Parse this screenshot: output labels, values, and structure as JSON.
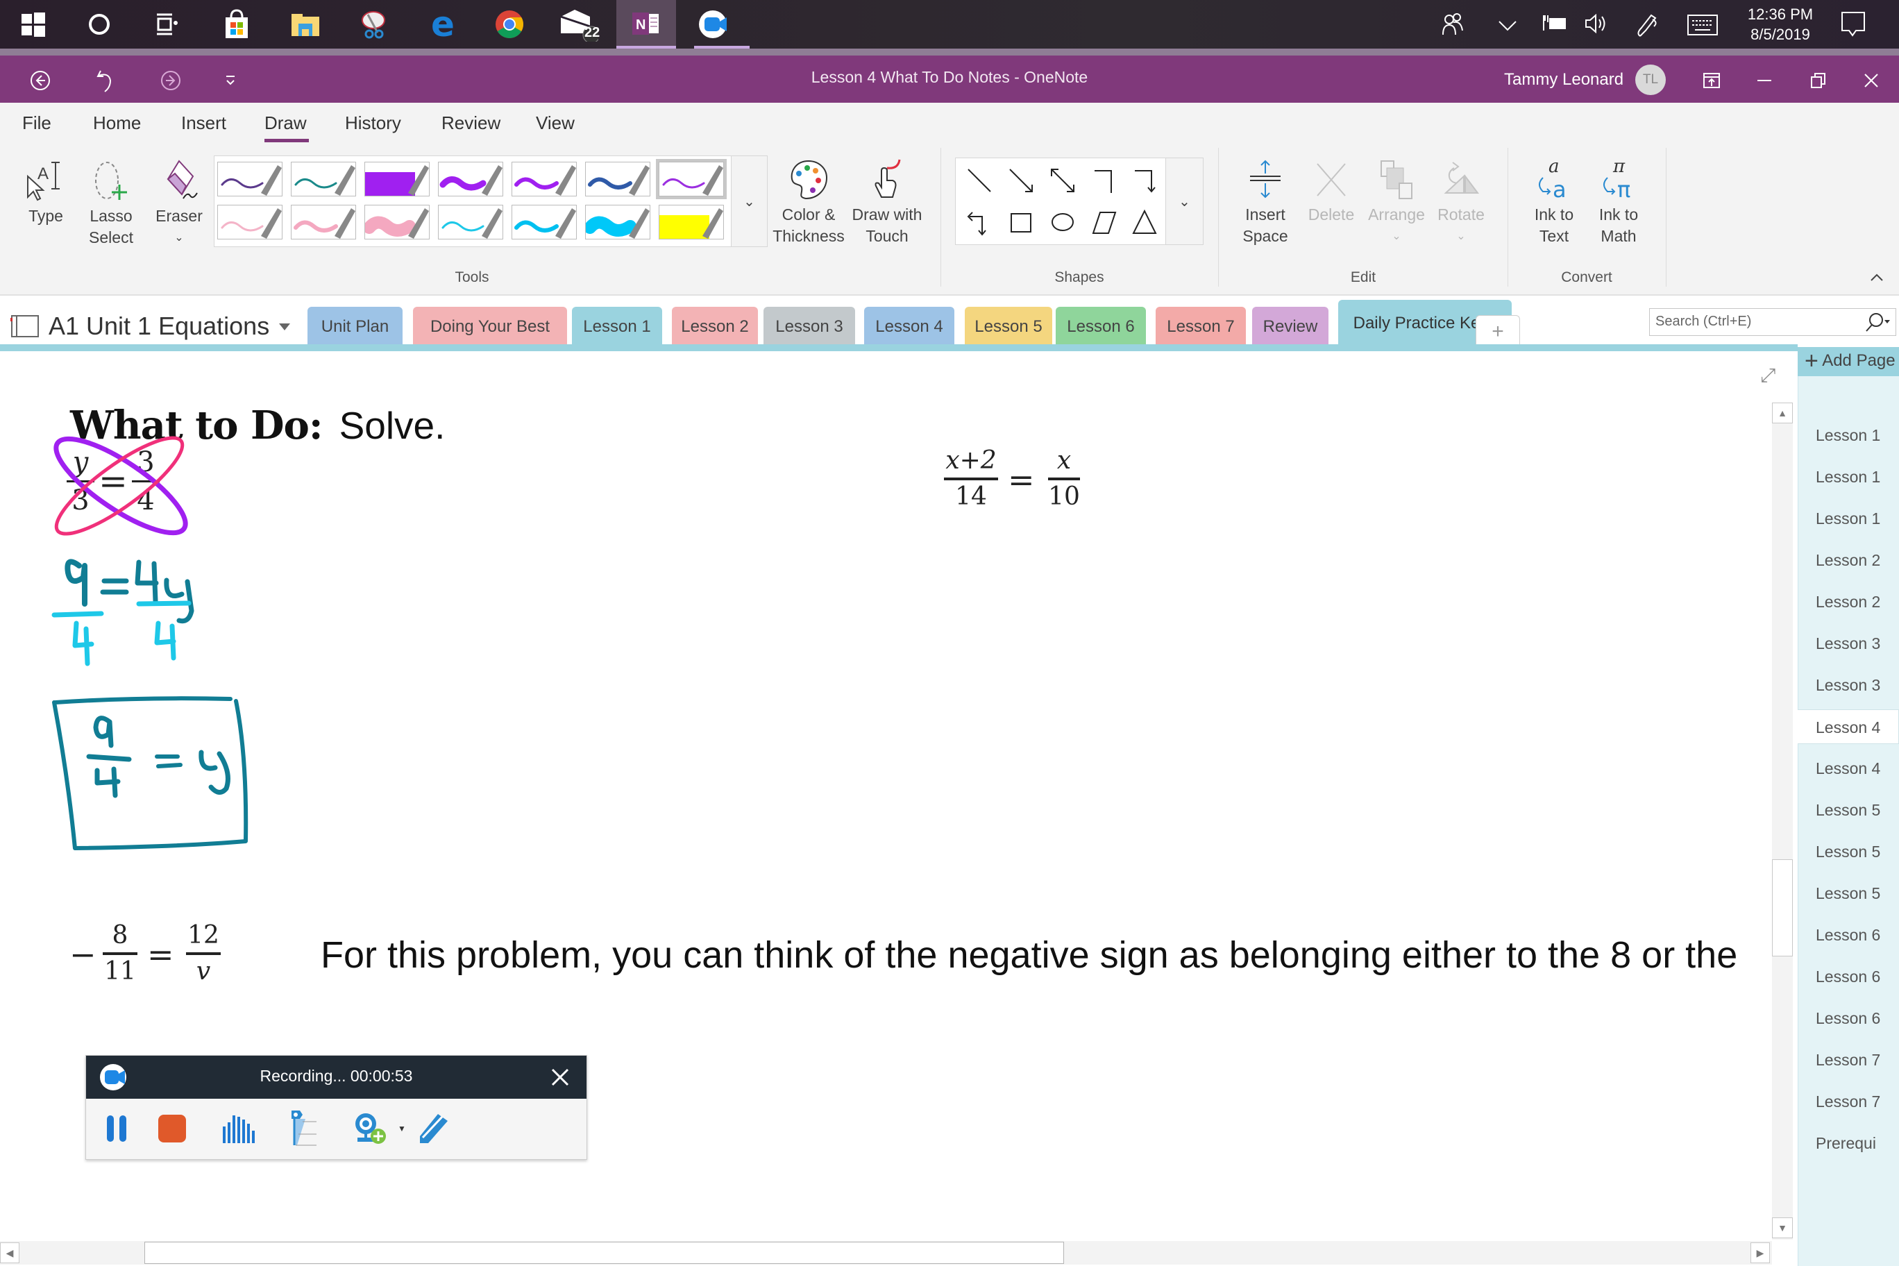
{
  "taskbar": {
    "apps": [
      {
        "name": "start",
        "label": "Start"
      },
      {
        "name": "cortana",
        "label": "Cortana"
      },
      {
        "name": "task-view",
        "label": "Task View"
      },
      {
        "name": "store",
        "label": "Microsoft Store"
      },
      {
        "name": "file-explorer",
        "label": "File Explorer"
      },
      {
        "name": "snipping-tool",
        "label": "Snipping Tool"
      },
      {
        "name": "edge",
        "label": "Microsoft Edge"
      },
      {
        "name": "chrome",
        "label": "Google Chrome"
      },
      {
        "name": "mail",
        "label": "Mail",
        "badge": "22"
      },
      {
        "name": "onenote",
        "label": "OneNote",
        "active": true
      },
      {
        "name": "screen-recorder",
        "label": "Screen Recorder"
      }
    ],
    "clock": {
      "time": "12:36 PM",
      "date": "8/5/2019"
    }
  },
  "titlebar": {
    "title": "Lesson 4 What To Do Notes  -  OneNote",
    "user": "Tammy Leonard",
    "initials": "TL"
  },
  "ribbon": {
    "tabs": [
      "File",
      "Home",
      "Insert",
      "Draw",
      "History",
      "Review",
      "View"
    ],
    "active_tab": "Draw",
    "tools": {
      "type": "Type",
      "lasso": [
        "Lasso",
        "Select"
      ],
      "eraser": "Eraser",
      "group_label": "Tools",
      "pens": [
        {
          "color": "#5b3a8c",
          "style": "thin"
        },
        {
          "color": "#1a8a8a",
          "style": "thin"
        },
        {
          "color": "#a020f0",
          "style": "highlighter"
        },
        {
          "color": "#a020f0",
          "style": "thick"
        },
        {
          "color": "#a020f0",
          "style": "medium"
        },
        {
          "color": "#2f5aa8",
          "style": "medium"
        },
        {
          "color": "#9b2fe0",
          "style": "thin",
          "selected": true
        },
        {
          "color": "#f4b4c8",
          "style": "thin"
        },
        {
          "color": "#f4a8c0",
          "style": "medium"
        },
        {
          "color": "#f4a8c0",
          "style": "highlighter-wave"
        },
        {
          "color": "#1ec8e8",
          "style": "thin"
        },
        {
          "color": "#00c0f0",
          "style": "medium"
        },
        {
          "color": "#00c8f8",
          "style": "highlighter-wave"
        },
        {
          "color": "#ffff00",
          "style": "highlighter"
        }
      ],
      "color_thickness": [
        "Color &",
        "Thickness"
      ],
      "draw_with_touch": [
        "Draw with",
        "Touch"
      ]
    },
    "shapes": {
      "group_label": "Shapes",
      "items": [
        "line",
        "arrow",
        "double-arrow",
        "elbow",
        "elbow-arrow",
        "elbow-arrow-left",
        "rectangle",
        "ellipse",
        "parallelogram",
        "triangle"
      ]
    },
    "edit": {
      "group_label": "Edit",
      "insert_space": [
        "Insert",
        "Space"
      ],
      "delete": "Delete",
      "arrange": "Arrange",
      "rotate": "Rotate"
    },
    "convert": {
      "group_label": "Convert",
      "ink_to_text": [
        "Ink to",
        "Text"
      ],
      "ink_to_math": [
        "Ink to",
        "Math"
      ]
    }
  },
  "notebook": {
    "name": "A1 Unit 1 Equations",
    "sections": [
      {
        "label": "Unit Plan",
        "color": "#9dc3e6"
      },
      {
        "label": "Doing Your Best",
        "color": "#f3b3b5"
      },
      {
        "label": "Lesson 1",
        "color": "#9ad3df"
      },
      {
        "label": "Lesson 2",
        "color": "#f3b3b5"
      },
      {
        "label": "Lesson 3",
        "color": "#c3c9cc"
      },
      {
        "label": "Lesson 4",
        "color": "#9dc3e6"
      },
      {
        "label": "Lesson 5",
        "color": "#f4d67f"
      },
      {
        "label": "Lesson 6",
        "color": "#8fd59b"
      },
      {
        "label": "Lesson 7",
        "color": "#f3aaa8"
      },
      {
        "label": "Review",
        "color": "#d3a8d8"
      },
      {
        "label": "Daily Practice Keys",
        "color": "#9ad3df",
        "active": true
      }
    ],
    "add_section": "+",
    "search_placeholder": "Search (Ctrl+E)"
  },
  "pages": {
    "add_page": "Add Page",
    "items": [
      "Lesson 1",
      "Lesson 1",
      "Lesson 1",
      "Lesson 2",
      "Lesson 2",
      "Lesson 3",
      "Lesson 3",
      "Lesson 4",
      "Lesson 4",
      "Lesson 5",
      "Lesson 5",
      "Lesson 5",
      "Lesson 6",
      "Lesson 6",
      "Lesson 6",
      "Lesson 7",
      "Lesson 7",
      "Prerequi"
    ],
    "active_index": 7
  },
  "content": {
    "heading_bold": "What to Do:",
    "heading_rest": "Solve.",
    "problem1": {
      "num_left": "y",
      "den_left": "3",
      "num_right": "3",
      "den_right": "4"
    },
    "problem2": {
      "num_left": "x+2",
      "den_left": "14",
      "num_right": "x",
      "den_right": "10"
    },
    "problem3": {
      "sign": "−",
      "num_left": "8",
      "den_left": "11",
      "num_right": "12",
      "den_right": "v"
    },
    "explanation": "For this problem, you can think of the negative sign as belonging either to the 8 or the",
    "ink": {
      "step1": "9/4 = 4y/4",
      "answer": "9/4 = y",
      "colors": {
        "purple": "#a020f0",
        "pink": "#f0307a",
        "teal": "#117d94",
        "cyan": "#1ec8e8"
      }
    }
  },
  "recorder": {
    "status": "Recording... 00:00:53",
    "buttons": [
      "pause",
      "stop",
      "audio",
      "annotate-marker",
      "webcam",
      "pen"
    ]
  }
}
